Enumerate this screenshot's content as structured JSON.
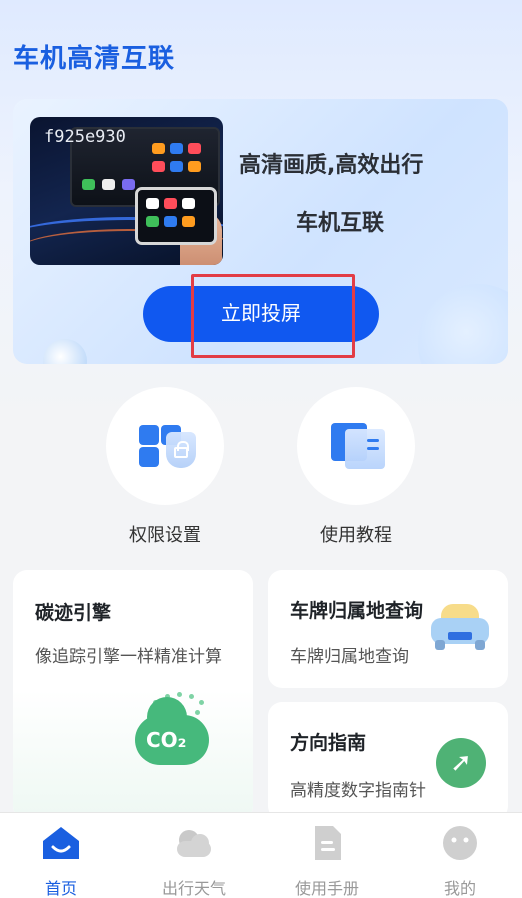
{
  "app": {
    "title": "车机高清互联"
  },
  "hero": {
    "image_code": "f925e930",
    "headline": "高清画质,高效出行",
    "subheadline": "车机互联",
    "cast_button": "立即投屏"
  },
  "shortcuts": [
    {
      "label": "权限设置",
      "icon": "permission-lock-icon"
    },
    {
      "label": "使用教程",
      "icon": "book-icon"
    }
  ],
  "cards": {
    "carbon": {
      "title": "碳迹引擎",
      "subtitle": "像追踪引擎一样精准计算",
      "icon": "co2-cloud-icon",
      "icon_text": "CO₂"
    },
    "plate": {
      "title": "车牌归属地查询",
      "subtitle": "车牌归属地查询",
      "icon": "car-icon"
    },
    "compass": {
      "title": "方向指南",
      "subtitle": "高精度数字指南针",
      "icon": "compass-icon",
      "icon_glyph": "➚"
    }
  },
  "nav": {
    "items": [
      {
        "label": "首页",
        "icon": "home-icon",
        "active": true
      },
      {
        "label": "出行天气",
        "icon": "cloud-icon",
        "active": false
      },
      {
        "label": "使用手册",
        "icon": "document-icon",
        "active": false
      },
      {
        "label": "我的",
        "icon": "profile-icon",
        "active": false
      }
    ]
  },
  "colors": {
    "primary": "#1058f0",
    "title_blue": "#1a5fe0",
    "highlight_red": "#e23c45",
    "compass_green": "#4fb275",
    "co2_green": "#46b97c"
  }
}
